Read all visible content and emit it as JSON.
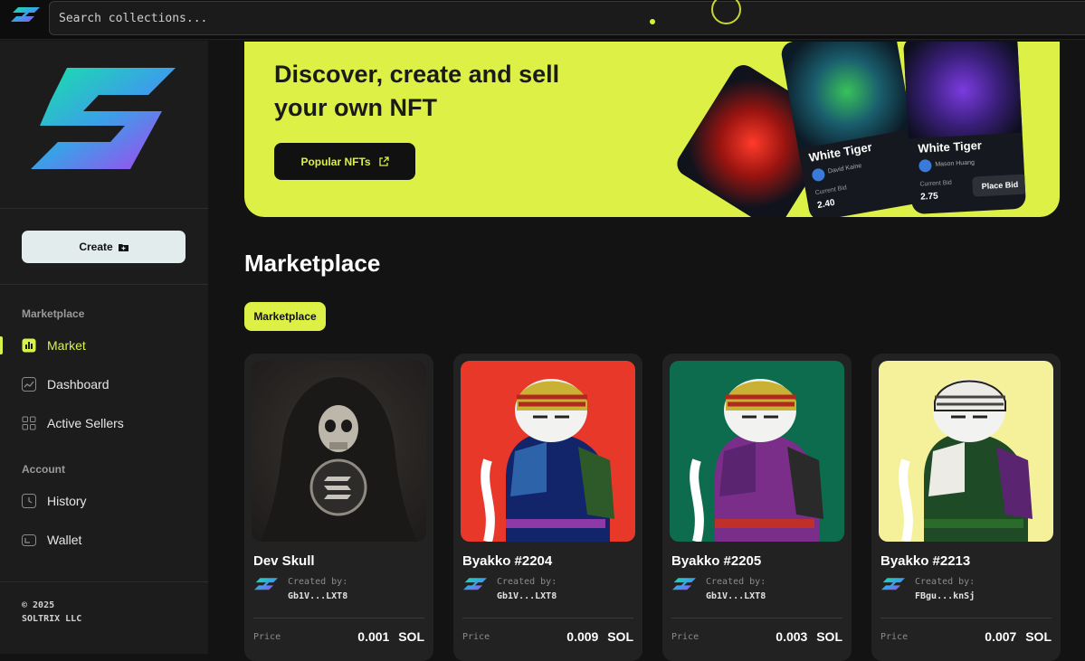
{
  "search": {
    "placeholder": "Search collections..."
  },
  "sidebar": {
    "create_label": "Create",
    "sections": [
      {
        "title": "Marketplace"
      },
      {
        "title": "Account"
      }
    ],
    "items": [
      {
        "label": "Market",
        "icon": "chart-icon",
        "active": true
      },
      {
        "label": "Dashboard",
        "icon": "trend-icon",
        "active": false
      },
      {
        "label": "Active Sellers",
        "icon": "grid-icon",
        "active": false
      },
      {
        "label": "History",
        "icon": "clock-icon",
        "active": false
      },
      {
        "label": "Wallet",
        "icon": "wallet-icon",
        "active": false
      }
    ],
    "footer": {
      "line1": "© 2025",
      "line2": "SOLTRIX LLC"
    }
  },
  "hero": {
    "title": "Discover, create and sell your own NFT",
    "button_label": "Popular NFTs",
    "cards": [
      {
        "name": "White Tiger",
        "author": "David Kaine",
        "bid_label": "Current Bid",
        "bid": "2.40"
      },
      {
        "name": "White Tiger",
        "author": "Mason Huang",
        "bid_label": "Current Bid",
        "bid": "2.75",
        "button": "Place Bid"
      }
    ]
  },
  "marketplace": {
    "title": "Marketplace",
    "chip": "Marketplace",
    "created_label": "Created by:",
    "price_label": "Price",
    "items": [
      {
        "name": "Dev Skull",
        "creator": "Gb1V...LXT8",
        "price": "0.001 SOL"
      },
      {
        "name": "Byakko #2204",
        "creator": "Gb1V...LXT8",
        "price": "0.009 SOL"
      },
      {
        "name": "Byakko #2205",
        "creator": "Gb1V...LXT8",
        "price": "0.003 SOL"
      },
      {
        "name": "Byakko #2213",
        "creator": "FBgu...knSj",
        "price": "0.007 SOL"
      }
    ]
  },
  "colors": {
    "accent": "#dcf045",
    "background": "#131313",
    "sidebar": "#1c1c1c",
    "card": "#222222"
  }
}
